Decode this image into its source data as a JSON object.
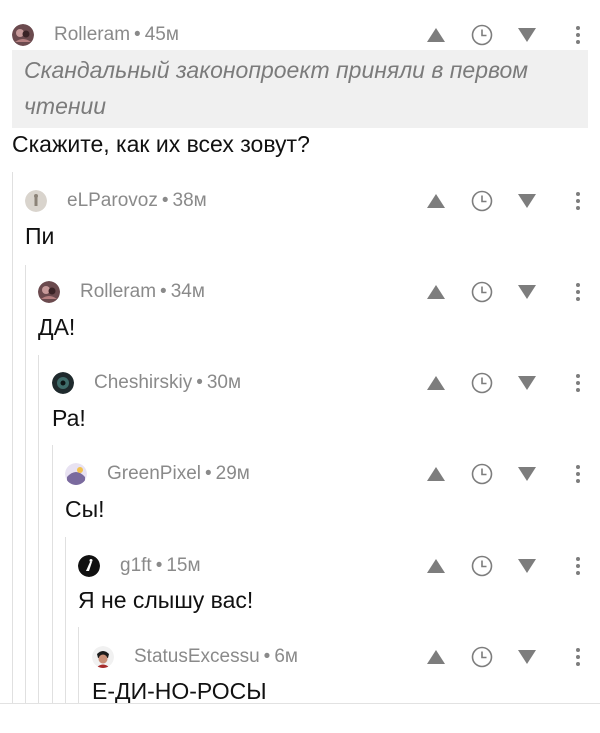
{
  "root": {
    "author": "Rolleram",
    "time": "45м",
    "quote": "Скандальный законопроект приняли в первом чтении",
    "text": "Скажите, как их всех зовут?"
  },
  "replies": [
    {
      "author": "eLParovoz",
      "time": "38м",
      "text": "Пи"
    },
    {
      "author": "Rolleram",
      "time": "34м",
      "text": "ДА!"
    },
    {
      "author": "Cheshirskiy",
      "time": "30м",
      "text": "Ра!"
    },
    {
      "author": "GreenPixel",
      "time": "29м",
      "text": "Сы!"
    },
    {
      "author": "g1ft",
      "time": "15м",
      "text": "Я не слышу вас!"
    },
    {
      "author": "StatusExcessu",
      "time": "6м",
      "text": "Е-ДИ-НО-РОСЫ"
    }
  ],
  "separator": "•",
  "icons": [
    "upvote-icon",
    "save-later-icon",
    "downvote-icon",
    "more-options-icon"
  ],
  "colors": {
    "meta": "#8a8a8a",
    "icon": "#7d7d7d",
    "quote_bg": "#f0f0f0",
    "thread_line": "#e0e0e0"
  }
}
